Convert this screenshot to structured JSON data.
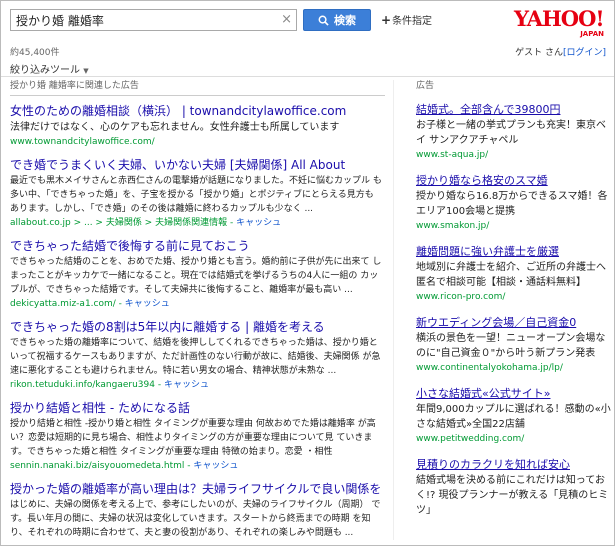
{
  "search": {
    "query": "授かり婚 離婚率",
    "clear": "×",
    "button_label": "検索",
    "conditions_label": "条件指定"
  },
  "logo": {
    "text": "YAHOO!",
    "sub": "JAPAN"
  },
  "stats": {
    "count": "約45,400件"
  },
  "user": {
    "guest": "ゲスト",
    "san": "さん",
    "login": "[ログイン]"
  },
  "filter": {
    "label": "絞り込みツール"
  },
  "main": {
    "ad_label": "授かり婚 離婚率に関連した広告",
    "results": [
      {
        "title": "女性のための離婚相談（横浜） | townandcitylawoffice.com",
        "desc": "法律だけではなく、心のケアも忘れません。女性弁護士も所属しています",
        "url": "www.townandcitylawoffice.com/",
        "cache": ""
      },
      {
        "title": "でき婚でうまくいく夫婦、いかない夫婦 [夫婦関係] All About",
        "desc": "最近でも黒木メイサさんと赤西仁さんの電撃婚が話題になりました。不妊に悩むカップル も多い中、「できちゃった婚」を、子宝を授かる「授かり婚」とポジティブにとらえる見方も あります。しかし、「でき婚」のその後は離婚に終わるカップルも少なく ...",
        "url": "allabout.co.jp > ... > 夫婦関係 > 夫婦関係関連情報",
        "cache": "キャッシュ"
      },
      {
        "title": "できちゃった結婚で後悔する前に見ておこう",
        "desc": "できちゃった結婚のことを、おめでた婚、授かり婚とも言う。婚約前に子供が先に出来て しまったことがキッカケで一緒になること。現在では結婚式を挙げるうちの4人に一組の カップルが、できちゃった結婚です。そして夫婦共に後悔すること、離婚率が最も高い ...",
        "url": "dekicyatta.miz-a1.com/",
        "cache": "キャッシュ"
      },
      {
        "title": "できちゃった婚の8割は5年以内に離婚する | 離婚を考える",
        "desc": "できちゃった婚の離婚率について、結婚を後押ししてくれるできちゃった婚は、授かり婚と いって祝福するケースもありますが、ただ計画性のない行動が故に、結婚後、夫婦関係 が急速に悪化することも避けられません。特に若い男女の場合、精神状態が未熟な ...",
        "url": "rikon.tetuduki.info/kangaeru394",
        "cache": "キャッシュ"
      },
      {
        "title": "授かり結婚と相性 - ためになる話",
        "desc": "授かり結婚と相性 -授かり婚と相性 タイミングが重要な理由 何故おめでた婚は離婚率 が高い？恋愛は短期的に見ち場合、相性よりタイミングの方が重要な理由について見 ていきます。できちゃった婚と相性 タイミングが重要な理由 特徴の始まり。恋愛 ・相性",
        "url": "sennin.nanaki.biz/aisyouomedeta.html",
        "cache": "キャッシュ"
      },
      {
        "title": "授かった婚の離婚率が高い理由は？夫婦ライフサイクルで良い関係を ...",
        "desc": "はじめに、夫婦の関係を考える上で、参考にしたいのが、夫婦のライフサイクル（周期） です。長い年月の間に、夫婦の状況は変化していきます。スタートから終焉までの時期 を知り、それぞれの時期に合わせて、夫と妻の役割があり、それぞれの楽しみや問題も ...",
        "url": "",
        "cache": ""
      }
    ]
  },
  "side": {
    "ad_label": "広告",
    "ads": [
      {
        "title": "結婚式。全部含んで39800円",
        "desc": "お子様と一緒の挙式プランも充実！東京ベイ サンアクアチャペル",
        "url": "www.st-aqua.jp/"
      },
      {
        "title": "授かり婚なら格安のスマ婚",
        "desc": "授かり婚なら16.8万からできるスマ婚！各エリア100会場と提携",
        "url": "www.smakon.jp/"
      },
      {
        "title": "離婚問題に強い弁護士を厳選",
        "desc": "地域別に弁護士を紹介、ご近所の弁護士へ匿名で相談可能【相談・通話料無料】",
        "url": "www.ricon-pro.com/"
      },
      {
        "title": "新ウエディング会場／自己資金0",
        "desc": "横浜の景色を一望！ニューオープン会場なのに\"自己資金０\"から叶う新プラン発表",
        "url": "www.continentalyokohama.jp/lp/"
      },
      {
        "title": "小さな結婚式«公式サイト»",
        "desc": "年間9,000カップルに選ばれる！感動の«小さな結婚式»全国22店舗",
        "url": "www.petitwedding.com/"
      },
      {
        "title": "見積りのカラクリを知れば安心",
        "desc": "結婚式場を決める前にこれだけは知っておく!? 現役プランナーが教える「見積のヒミツ」",
        "url": ""
      }
    ]
  },
  "colors": {
    "link": "#1a0dab",
    "url_green": "#009933",
    "search_blue": "#3c7fd8",
    "yahoo_red": "#e60012"
  },
  "icons": {
    "search": "magnifier-icon",
    "plus": "plus-icon",
    "dropdown": "triangle-down-icon"
  }
}
